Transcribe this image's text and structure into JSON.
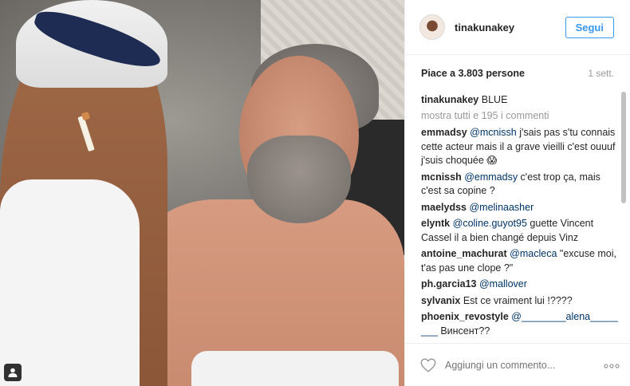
{
  "post": {
    "username": "tinakunakey",
    "follow_label": "Segui",
    "likes_text": "Piace a 3.803 persone",
    "time_text": "1 sett.",
    "caption_text": "BLUE",
    "load_more_text": "mostra tutti e 195 i commenti"
  },
  "comments": [
    {
      "user": "emmadsy",
      "mention": "@mcnissh",
      "text": " j'sais pas s'tu connais cette acteur mais il a grave vieilli c'est ouuuf j'suis choquée 😱"
    },
    {
      "user": "mcnissh",
      "mention": "@emmadsy",
      "text": " c'est trop ça, mais c'est sa copine ?"
    },
    {
      "user": "maelydss",
      "mention": "@melinaasher",
      "text": ""
    },
    {
      "user": "elyntk",
      "mention": "@coline.guyot95",
      "text": " guette Vincent Cassel il a bien changé depuis Vinz"
    },
    {
      "user": "antoine_machurat",
      "mention": "@macleca",
      "text": " \"excuse moi, t'as pas une clope ?\""
    },
    {
      "user": "ph.garcia13",
      "mention": "@mallover",
      "text": ""
    },
    {
      "user": "sylvanix",
      "mention": "",
      "text": "Est ce vraiment lui !????"
    },
    {
      "user": "phoenix_revostyle",
      "mention": "@________alena_____ ___",
      "text": " Винсент??"
    }
  ],
  "footer": {
    "comment_placeholder": "Aggiungi un commento...",
    "more_label": "ooo"
  },
  "icons": {
    "heart": "heart-icon",
    "more": "more-options-icon",
    "tag": "user-tag-icon"
  },
  "colors": {
    "accent": "#3897f0",
    "mention": "#003569",
    "muted": "#999999"
  }
}
